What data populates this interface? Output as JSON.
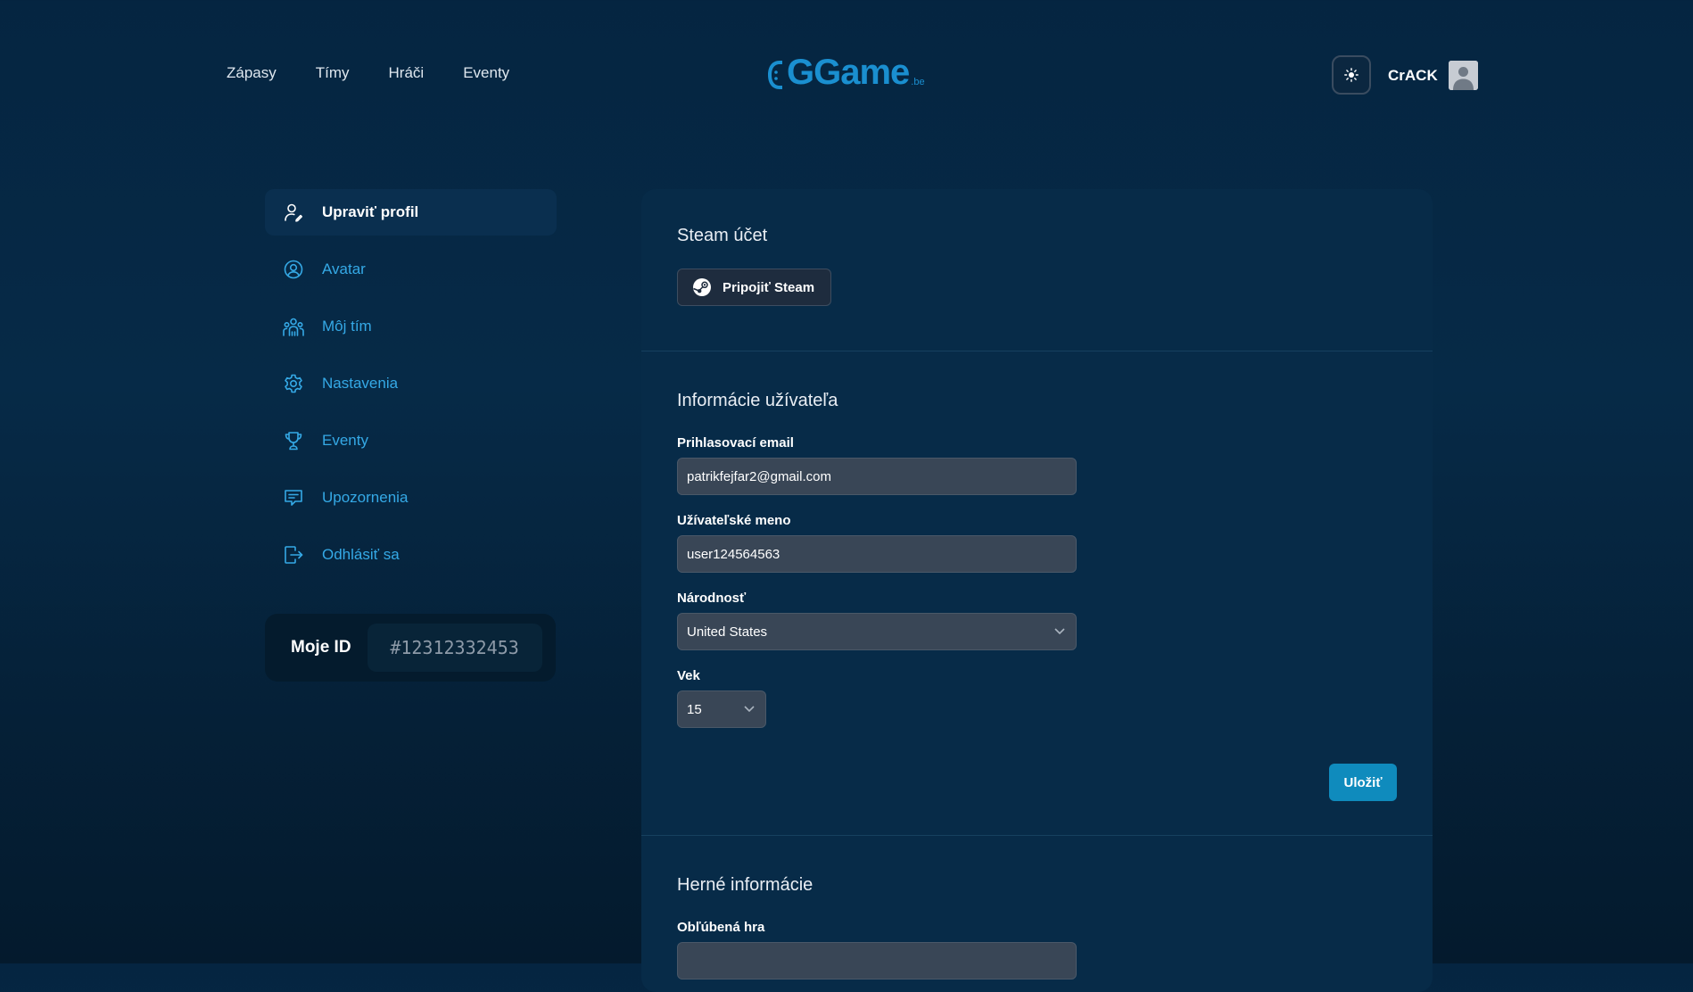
{
  "header": {
    "nav": [
      "Zápasy",
      "Tímy",
      "Hráči",
      "Eventy"
    ],
    "logo_text": "GGame",
    "logo_tld": ".be",
    "username": "CrACK",
    "theme_icon": "sun-icon"
  },
  "sidebar": {
    "items": [
      {
        "label": "Upraviť profil",
        "icon": "user-edit-icon"
      },
      {
        "label": "Avatar",
        "icon": "user-circle-icon"
      },
      {
        "label": "Môj tím",
        "icon": "team-icon"
      },
      {
        "label": "Nastavenia",
        "icon": "gear-icon"
      },
      {
        "label": "Eventy",
        "icon": "trophy-icon"
      },
      {
        "label": "Upozornenia",
        "icon": "notification-icon"
      },
      {
        "label": "Odhlásiť sa",
        "icon": "logout-icon"
      }
    ],
    "myid_label": "Moje ID",
    "myid_value": "#12312332453"
  },
  "steam": {
    "title": "Steam účet",
    "connect_label": "Pripojiť Steam"
  },
  "user_info": {
    "title": "Informácie užívateľa",
    "email_label": "Prihlasovací email",
    "email_value": "patrikfejfar2@gmail.com",
    "username_label": "Užívateľské meno",
    "username_value": "user124564563",
    "nationality_label": "Národnosť",
    "nationality_value": "United States",
    "age_label": "Vek",
    "age_value": "15",
    "save_label": "Uložiť"
  },
  "game_info": {
    "title": "Herné informácie",
    "favorite_game_label": "Obľúbená hra"
  },
  "colors": {
    "accent": "#35a9e6",
    "button": "#0f8bbd",
    "panel": "#072b48",
    "background": "#052541"
  }
}
